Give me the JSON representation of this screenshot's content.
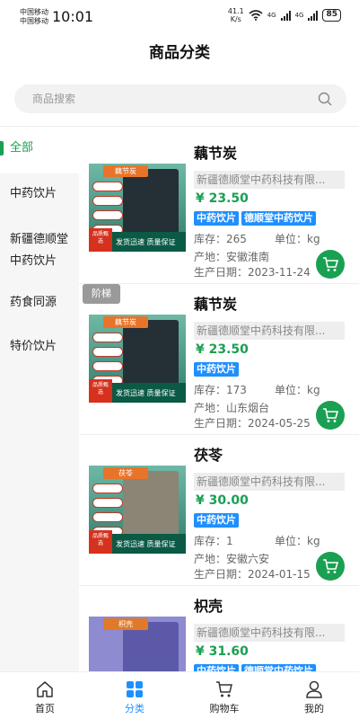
{
  "status_bar": {
    "carrier_1": "中国移动",
    "carrier_2": "中国移动",
    "time": "10:01",
    "net_speed_value": "41.1",
    "net_speed_unit": "K/s",
    "signal_1": "4G",
    "signal_2": "4G",
    "battery": "85"
  },
  "header": {
    "title": "商品分类"
  },
  "search": {
    "placeholder": "商品搜索"
  },
  "sidebar": {
    "items": [
      {
        "label": "全部",
        "active": true
      },
      {
        "label": "中药饮片",
        "active": false
      },
      {
        "label": "新疆德顺堂中药饮片",
        "active": false
      },
      {
        "label": "药食同源",
        "active": false
      },
      {
        "label": "特价饮片",
        "active": false
      }
    ]
  },
  "floating_badge": "阶梯",
  "products": [
    {
      "name": "藕节炭",
      "company": "新疆德顺堂中药科技有限...",
      "price": "¥ 23.50",
      "tags": [
        "中药饮片",
        "德顺堂中药饮片"
      ],
      "stock": "库存：265",
      "unit": "单位：kg",
      "origin": "产地：安徽淮南",
      "date": "生产日期：2023-11-24",
      "thumb_tag": "藕节炭",
      "thumb_quality": "品质甄选",
      "thumb_footer": "发货迅速   质量保证"
    },
    {
      "name": "藕节炭",
      "company": "新疆德顺堂中药科技有限...",
      "price": "¥ 23.50",
      "tags": [
        "中药饮片"
      ],
      "stock": "库存：173",
      "unit": "单位：kg",
      "origin": "产地：山东烟台",
      "date": "生产日期：2024-05-25",
      "thumb_tag": "藕节炭",
      "thumb_quality": "品质甄选",
      "thumb_footer": "发货迅速   质量保证"
    },
    {
      "name": "茯苓",
      "company": "新疆德顺堂中药科技有限...",
      "price": "¥ 30.00",
      "tags": [
        "中药饮片"
      ],
      "stock": "库存：1",
      "unit": "单位：kg",
      "origin": "产地：安徽六安",
      "date": "生产日期：2024-01-15",
      "thumb_tag": "茯苓",
      "thumb_quality": "品质甄选",
      "thumb_footer": "发货迅速   质量保证"
    },
    {
      "name": "枳壳",
      "company": "新疆德顺堂中药科技有限...",
      "price": "¥ 31.60",
      "tags": [
        "中药饮片",
        "德顺堂中药饮片"
      ],
      "thumb_tag": "枳壳"
    }
  ],
  "bottom_nav": [
    {
      "label": "首页",
      "icon": "home-icon",
      "active": false
    },
    {
      "label": "分类",
      "icon": "category-icon",
      "active": true
    },
    {
      "label": "购物车",
      "icon": "cart-icon",
      "active": false
    },
    {
      "label": "我的",
      "icon": "user-icon",
      "active": false
    }
  ],
  "colors": {
    "accent_green": "#1aa052",
    "tag_blue": "#1e8fff",
    "nav_active": "#1e8fff"
  }
}
